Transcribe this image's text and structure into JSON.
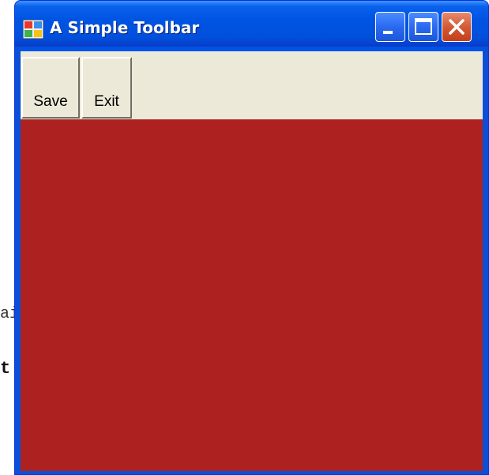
{
  "window": {
    "title": "A Simple Toolbar",
    "controls": {
      "minimize": "minimize-icon",
      "maximize": "maximize-icon",
      "close": "close-icon"
    },
    "client_background_color": "#ae2121",
    "frame_color": "#0054e3"
  },
  "toolbar": {
    "buttons": [
      {
        "label": "Save"
      },
      {
        "label": "Exit"
      }
    ]
  },
  "background": {
    "fragment_1": "ai",
    "fragment_2": "t:"
  }
}
